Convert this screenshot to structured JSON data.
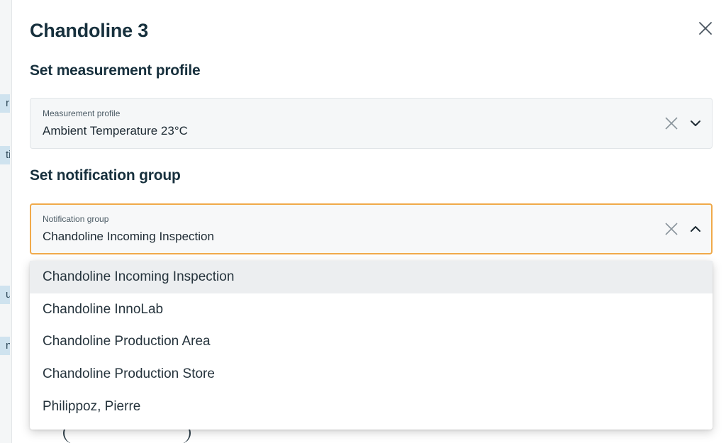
{
  "drawer": {
    "title": "Chandoline 3"
  },
  "measurement": {
    "heading": "Set measurement profile",
    "field_label": "Measurement profile",
    "field_value": "Ambient Temperature 23°C"
  },
  "notification": {
    "heading": "Set notification group",
    "field_label": "Notification group",
    "field_value": "Chandoline Incoming Inspection",
    "options": [
      "Chandoline Incoming Inspection",
      "Chandoline InnoLab",
      "Chandoline Production Area",
      "Chandoline Production Store",
      "Philippoz, Pierre"
    ],
    "active_index": 0
  },
  "background_fragments": [
    "r",
    "ti",
    "u",
    "n"
  ],
  "icons": {
    "close": "close-icon",
    "clear": "clear-icon",
    "chevron_down": "chevron-down-icon",
    "chevron_up": "chevron-up-icon"
  },
  "colors": {
    "focus_border": "#f0a94a",
    "title_text": "#17303d",
    "active_option_bg": "#eceef0"
  }
}
